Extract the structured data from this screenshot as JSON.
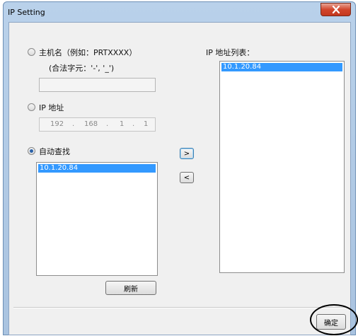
{
  "window": {
    "title": "IP Setting",
    "close_glyph": "X"
  },
  "hostname_option": {
    "label": "主机名（例如：PRTXXXX）",
    "hint": "(合法字元：'-', '_')",
    "value": ""
  },
  "ip_option": {
    "label": "IP 地址",
    "octets": [
      "192",
      "168",
      "1",
      "1"
    ],
    "dot": "."
  },
  "auto_option": {
    "label": "自动查找",
    "found": [
      "10.1.20.84"
    ]
  },
  "ip_list": {
    "label": "IP 地址列表：",
    "items": [
      "10.1.20.84"
    ]
  },
  "buttons": {
    "add": ">",
    "remove": "<",
    "refresh": "刷新",
    "ok": "确定"
  }
}
